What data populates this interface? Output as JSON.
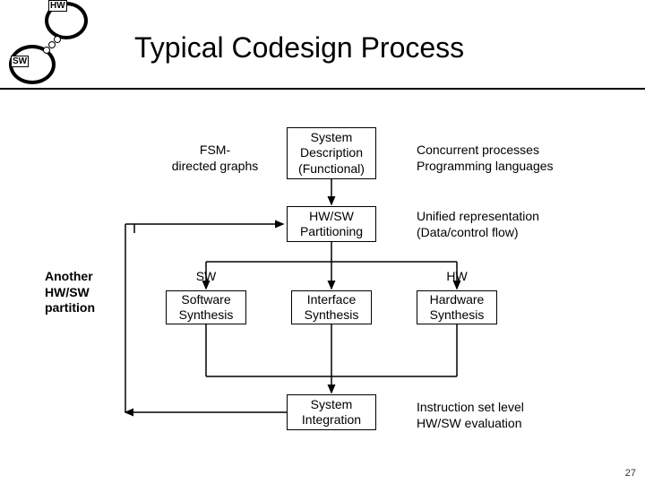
{
  "title": "Typical Codesign Process",
  "cuffs": {
    "hw": "HW",
    "sw": "SW"
  },
  "labels": {
    "fsm": "FSM-\ndirected graphs",
    "sw": "SW",
    "hw": "HW",
    "another": "Another\nHW/SW\npartition"
  },
  "boxes": {
    "sys_desc": "System\nDescription\n(Functional)",
    "partitioning": "HW/SW\nPartitioning",
    "sw_synth": "Software\nSynthesis",
    "if_synth": "Interface\nSynthesis",
    "hw_synth": "Hardware\nSynthesis",
    "sys_int": "System\nIntegration"
  },
  "notes": {
    "concurrent": "Concurrent processes\nProgramming languages",
    "unified": "Unified representation\n(Data/control flow)",
    "islevel": "Instruction set level\nHW/SW evaluation"
  },
  "page": "27"
}
